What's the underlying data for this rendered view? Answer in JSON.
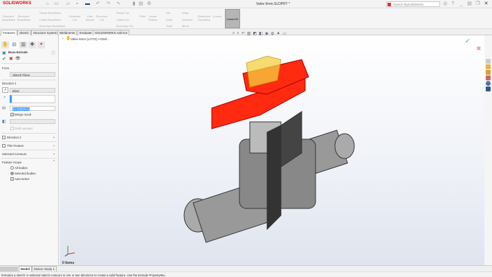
{
  "app": {
    "logo": "SOLIDWORKS",
    "title": "Valve 6mm.SLDPRT *",
    "search_placeholder": "Search MySolidWorks"
  },
  "ribbon": {
    "big": [
      "Extruded Boss/Base",
      "Revolved Boss/Base",
      "Extruded Cut",
      "Hole Wizard",
      "Revolved Cut",
      "Fillet",
      "Linear Pattern",
      "Reference Geometry",
      "Curves"
    ],
    "small": [
      "Swept Boss/Base",
      "Lofted Boss/Base",
      "Boundary Boss/Base",
      "Swept Cut",
      "Lofted Cut",
      "Boundary Cut",
      "Rib",
      "Draft",
      "Shell",
      "Wrap",
      "Intersect",
      "Mirror"
    ],
    "instant3d": "Instant3D"
  },
  "tabs": [
    "Features",
    "Sketch",
    "Structure System",
    "Weldments",
    "Evaluate",
    "SOLIDWORKS Add-Ins"
  ],
  "tree": {
    "root": "Valve 6mm (LOTO) <<Def..."
  },
  "panel": {
    "title": "Boss-Extrude",
    "from_label": "From",
    "from_value": "Sketch Plane",
    "dir1_label": "Direction 1",
    "dir1_type": "Blind",
    "depth": "10.00000mm",
    "merge": "Merge result",
    "draft_outward": "Draft outward",
    "dir2": "Direction 2",
    "thin": "Thin Feature",
    "contours": "Selected Contours",
    "scope": "Feature Scope",
    "scope_opts": [
      "All bodies",
      "Selected bodies",
      "Auto-select"
    ]
  },
  "viewport": {
    "items": "0 Items"
  },
  "bottom_tabs": [
    "Model",
    "Motion Study 1"
  ],
  "status": "Extrudes a sketch or selected sketch contours in one or two directions to create a solid feature. Use the Extrude PropertyMa...",
  "colors": {
    "brand": "#d11a1a",
    "handle": "#ff2a10",
    "preview": "#f5d040",
    "accent": "#3399ff"
  }
}
